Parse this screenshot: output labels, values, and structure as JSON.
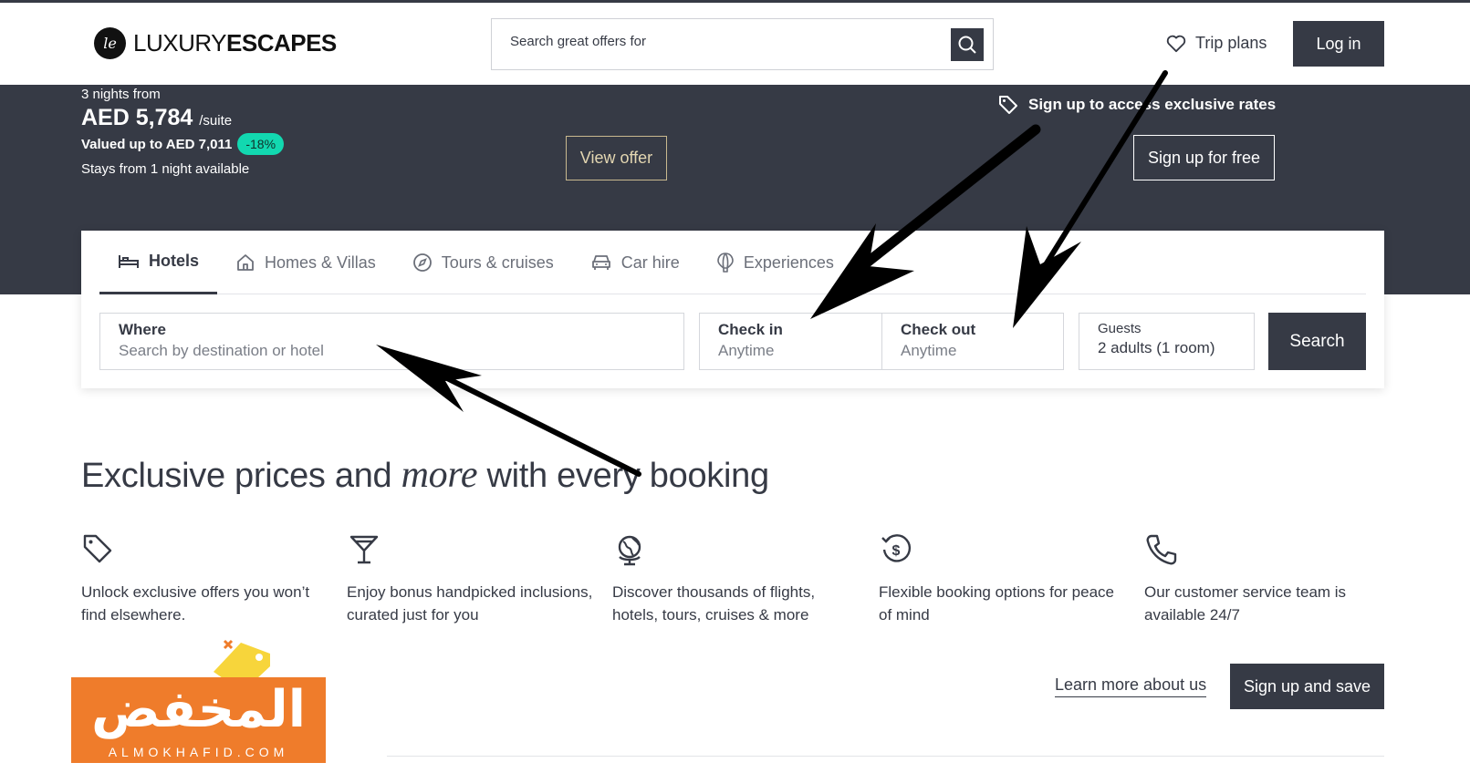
{
  "header": {
    "logo_mark": "le",
    "logo_light": "LUXURY",
    "logo_bold": "ESCAPES",
    "search_placeholder": "Search great offers for",
    "trip_plans": "Trip plans",
    "login": "Log in"
  },
  "banner": {
    "nights": "3 nights from",
    "price": "AED 5,784",
    "per": "/suite",
    "valued": "Valued up to AED 7,011",
    "discount": "-18%",
    "stays": "Stays from 1 night available",
    "view_offer": "View offer",
    "signup_text": "Sign up to access exclusive rates",
    "signup_button": "Sign up for free"
  },
  "tabs": [
    {
      "label": "Hotels",
      "icon": "bed-icon"
    },
    {
      "label": "Homes & Villas",
      "icon": "home-icon"
    },
    {
      "label": "Tours & cruises",
      "icon": "compass-icon"
    },
    {
      "label": "Car hire",
      "icon": "car-icon"
    },
    {
      "label": "Experiences",
      "icon": "balloon-icon"
    }
  ],
  "form": {
    "where_label": "Where",
    "where_placeholder": "Search by destination or hotel",
    "checkin_label": "Check in",
    "checkin_value": "Anytime",
    "checkout_label": "Check out",
    "checkout_value": "Anytime",
    "guests_label": "Guests",
    "guests_value": "2 adults (1 room)",
    "search": "Search"
  },
  "headline": {
    "before": "Exclusive prices and ",
    "emph": "more",
    "after": " with every booking"
  },
  "features": [
    {
      "icon": "tag-icon",
      "text": "Unlock exclusive offers you won’t find elsewhere."
    },
    {
      "icon": "cocktail-icon",
      "text": "Enjoy bonus handpicked inclusions, curated just for you"
    },
    {
      "icon": "globe-icon",
      "text": "Discover thousands of flights, hotels, tours, cruises & more"
    },
    {
      "icon": "refund-icon",
      "text": "Flexible booking options for peace of mind"
    },
    {
      "icon": "phone-icon",
      "text": "Our customer service team is available 24/7"
    }
  ],
  "footer_actions": {
    "learn_more": "Learn more about us",
    "signup_save": "Sign up and save"
  },
  "watermark": {
    "arabic": "المخفض",
    "latin": "ALMOKHAFID.COM"
  }
}
